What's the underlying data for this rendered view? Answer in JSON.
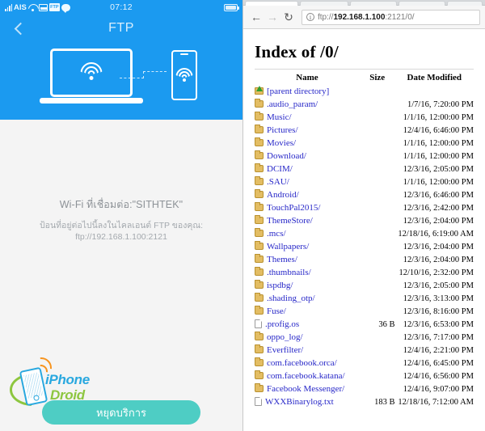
{
  "phone_app": {
    "status_bar": {
      "carrier": "AIS",
      "time": "07:12",
      "icons": [
        "signal-bars-icon",
        "wifi-icon",
        "image-icon",
        "ftp-icon",
        "chat-icon",
        "battery-icon"
      ]
    },
    "app_bar": {
      "back_icon": "back-chevron-icon",
      "title": "FTP"
    },
    "illustration": {
      "laptop_icon": "laptop-icon",
      "phone_icon": "phone-icon",
      "link_icon": "dashed-connection-icon",
      "wifi_icon": "wifi-icon"
    },
    "info": {
      "connected_label": "Wi-Fi ที่เชื่อมต่อ:\"SITHTEK\"",
      "instruction": "ป้อนที่อยู่ต่อไปนี้ลงในไคลเอนต์ FTP ของคุณ:",
      "url": "ftp://192.168.1.100:2121"
    },
    "watermark": {
      "line1": "iPhone",
      "line2": "Droid"
    },
    "stop_button_label": "หยุดบริการ",
    "colors": {
      "header_blue": "#1b9af0",
      "button_teal": "#4ecdc4",
      "page_bg": "#f4f4f4"
    }
  },
  "browser": {
    "nav": {
      "back_icon": "arrow-left-icon",
      "forward_icon": "arrow-right-icon",
      "reload_icon": "reload-icon",
      "site_info_icon": "info-circle-icon"
    },
    "omnibox": {
      "scheme": "ftp://",
      "host": "192.168.1.100",
      "path": ":2121/0/",
      "full_url": "ftp://192.168.1.100:2121/0/"
    },
    "page": {
      "title": "Index of /0/",
      "columns": [
        "Name",
        "Size",
        "Date Modified"
      ],
      "rows": [
        {
          "name": "[parent directory]",
          "icon": "parent-directory-icon",
          "size": "",
          "date": ""
        },
        {
          "name": ".audio_param/",
          "icon": "folder-icon",
          "size": "",
          "date": "1/7/16, 7:20:00 PM"
        },
        {
          "name": "Music/",
          "icon": "folder-icon",
          "size": "",
          "date": "1/1/16, 12:00:00 PM"
        },
        {
          "name": "Pictures/",
          "icon": "folder-icon",
          "size": "",
          "date": "12/4/16, 6:46:00 PM"
        },
        {
          "name": "Movies/",
          "icon": "folder-icon",
          "size": "",
          "date": "1/1/16, 12:00:00 PM"
        },
        {
          "name": "Download/",
          "icon": "folder-icon",
          "size": "",
          "date": "1/1/16, 12:00:00 PM"
        },
        {
          "name": "DCIM/",
          "icon": "folder-icon",
          "size": "",
          "date": "12/3/16, 2:05:00 PM"
        },
        {
          "name": ".SAU/",
          "icon": "folder-icon",
          "size": "",
          "date": "1/1/16, 12:00:00 PM"
        },
        {
          "name": "Android/",
          "icon": "folder-icon",
          "size": "",
          "date": "12/3/16, 6:46:00 PM"
        },
        {
          "name": "TouchPal2015/",
          "icon": "folder-icon",
          "size": "",
          "date": "12/3/16, 2:42:00 PM"
        },
        {
          "name": "ThemeStore/",
          "icon": "folder-icon",
          "size": "",
          "date": "12/3/16, 2:04:00 PM"
        },
        {
          "name": ".mcs/",
          "icon": "folder-icon",
          "size": "",
          "date": "12/18/16, 6:19:00 AM"
        },
        {
          "name": "Wallpapers/",
          "icon": "folder-icon",
          "size": "",
          "date": "12/3/16, 2:04:00 PM"
        },
        {
          "name": "Themes/",
          "icon": "folder-icon",
          "size": "",
          "date": "12/3/16, 2:04:00 PM"
        },
        {
          "name": ".thumbnails/",
          "icon": "folder-icon",
          "size": "",
          "date": "12/10/16, 2:32:00 PM"
        },
        {
          "name": "ispdbg/",
          "icon": "folder-icon",
          "size": "",
          "date": "12/3/16, 2:05:00 PM"
        },
        {
          "name": ".shading_otp/",
          "icon": "folder-icon",
          "size": "",
          "date": "12/3/16, 3:13:00 PM"
        },
        {
          "name": "Fuse/",
          "icon": "folder-icon",
          "size": "",
          "date": "12/3/16, 8:16:00 PM"
        },
        {
          "name": ".profig.os",
          "icon": "file-icon",
          "size": "36 B",
          "date": "12/3/16, 6:53:00 PM"
        },
        {
          "name": "oppo_log/",
          "icon": "folder-icon",
          "size": "",
          "date": "12/3/16, 7:17:00 PM"
        },
        {
          "name": "Everfilter/",
          "icon": "folder-icon",
          "size": "",
          "date": "12/4/16, 2:21:00 PM"
        },
        {
          "name": "com.facebook.orca/",
          "icon": "folder-icon",
          "size": "",
          "date": "12/4/16, 6:45:00 PM"
        },
        {
          "name": "com.facebook.katana/",
          "icon": "folder-icon",
          "size": "",
          "date": "12/4/16, 6:56:00 PM"
        },
        {
          "name": "Facebook Messenger/",
          "icon": "folder-icon",
          "size": "",
          "date": "12/4/16, 9:07:00 PM"
        },
        {
          "name": "WXXBinarylog.txt",
          "icon": "file-icon",
          "size": "183 B",
          "date": "12/18/16, 7:12:00 AM"
        }
      ]
    }
  }
}
